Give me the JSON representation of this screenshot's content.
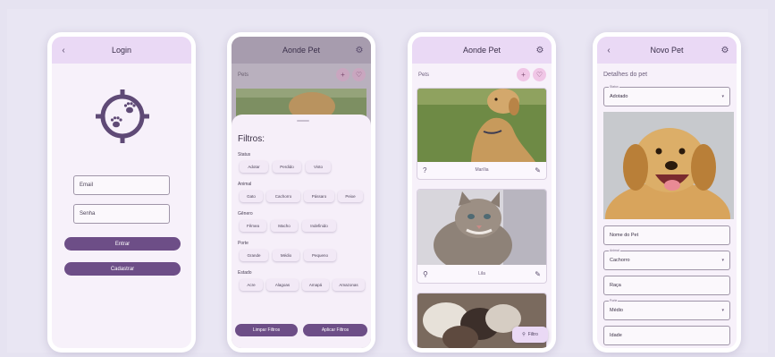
{
  "login": {
    "back_icon": "‹",
    "title": "Login",
    "email_value": "Email",
    "password_value": "Senha",
    "enter_label": "Entrar",
    "register_label": "Cadastrar"
  },
  "filters": {
    "title": "Aonde Pet",
    "settings_icon": "⚙",
    "pets_label": "Pets",
    "add_icon": "+",
    "heart_icon": "♡",
    "heading": "Filtros:",
    "groups": [
      {
        "title": "Status",
        "chips": [
          "Adotar",
          "Perdido",
          "Visto"
        ]
      },
      {
        "title": "Animal",
        "chips": [
          "Gato",
          "Cachorro",
          "Pássaro",
          "Peixe"
        ]
      },
      {
        "title": "Gênero",
        "chips": [
          "Fêmea",
          "Macho",
          "Indefinido"
        ]
      },
      {
        "title": "Porte",
        "chips": [
          "Grande",
          "Médio",
          "Pequeno"
        ]
      },
      {
        "title": "Estado",
        "chips": [
          "Acre",
          "Alagoas",
          "Amapá",
          "Amazonas"
        ]
      }
    ],
    "clear_label": "Limpar Filtros",
    "apply_label": "Aplicar Filtros"
  },
  "list": {
    "title": "Aonde Pet",
    "settings_icon": "⚙",
    "pets_label": "Pets",
    "add_icon": "+",
    "heart_icon": "♡",
    "cards": [
      {
        "name": "Marília",
        "left_icon": "?",
        "right_icon": "✎"
      },
      {
        "name": "Lila",
        "left_icon": "⚲",
        "right_icon": "✎"
      }
    ],
    "filter_button_label": "Filtro",
    "filter_icon": "⚲"
  },
  "form": {
    "back_icon": "‹",
    "title": "Novo Pet",
    "settings_icon": "⚙",
    "section_title": "Detalhes do pet",
    "status_label": "Status",
    "status_value": "Adotado",
    "name_value": "Nome do Pet",
    "animal_label": "Animal",
    "animal_value": "Cachorro",
    "breed_value": "Raça",
    "size_label": "Porte",
    "size_value": "Médio",
    "last_value": "Idade",
    "caret": "▾"
  }
}
